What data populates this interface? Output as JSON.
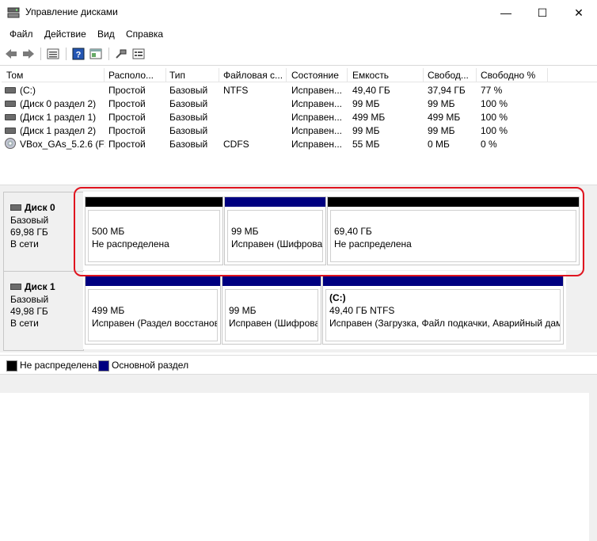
{
  "window": {
    "title": "Управление дисками",
    "controls": {
      "minimize": "—",
      "maximize": "☐",
      "close": "✕"
    }
  },
  "menu": [
    "Файл",
    "Действие",
    "Вид",
    "Справка"
  ],
  "toolbar_icons": [
    "back-icon",
    "forward-icon",
    "list-view-icon",
    "help-icon",
    "properties-icon",
    "connect-icon",
    "settings-icon"
  ],
  "volume_list": {
    "columns": [
      "Том",
      "Располо...",
      "Тип",
      "Файловая с...",
      "Состояние",
      "Емкость",
      "Свобод...",
      "Свободно %"
    ],
    "rows": [
      {
        "icon": "drive",
        "tom": "(C:)",
        "layout": "Простой",
        "type": "Базовый",
        "fs": "NTFS",
        "state": "Исправен...",
        "capacity": "49,40 ГБ",
        "free": "37,94 ГБ",
        "free_pct": "77 %"
      },
      {
        "icon": "drive",
        "tom": "(Диск 0 раздел 2)",
        "layout": "Простой",
        "type": "Базовый",
        "fs": "",
        "state": "Исправен...",
        "capacity": "99 МБ",
        "free": "99 МБ",
        "free_pct": "100 %"
      },
      {
        "icon": "drive",
        "tom": "(Диск 1 раздел 1)",
        "layout": "Простой",
        "type": "Базовый",
        "fs": "",
        "state": "Исправен...",
        "capacity": "499 МБ",
        "free": "499 МБ",
        "free_pct": "100 %"
      },
      {
        "icon": "drive",
        "tom": "(Диск 1 раздел 2)",
        "layout": "Простой",
        "type": "Базовый",
        "fs": "",
        "state": "Исправен...",
        "capacity": "99 МБ",
        "free": "99 МБ",
        "free_pct": "100 %"
      },
      {
        "icon": "cd",
        "tom": "VBox_GAs_5.2.6 (F:)",
        "layout": "Простой",
        "type": "Базовый",
        "fs": "CDFS",
        "state": "Исправен...",
        "capacity": "55 МБ",
        "free": "0 МБ",
        "free_pct": "0 %"
      }
    ]
  },
  "disks": [
    {
      "name": "Диск 0",
      "type": "Базовый",
      "size": "69,98 ГБ",
      "status": "В сети",
      "partitions": [
        {
          "title": "",
          "line1": "500 МБ",
          "line2": "Не распределена",
          "color": "#000000"
        },
        {
          "title": "",
          "line1": "99 МБ",
          "line2": "Исправен (Шифрова",
          "color": "#000080"
        },
        {
          "title": "",
          "line1": "69,40 ГБ",
          "line2": "Не распределена",
          "color": "#000000"
        }
      ]
    },
    {
      "name": "Диск 1",
      "type": "Базовый",
      "size": "49,98 ГБ",
      "status": "В сети",
      "partitions": [
        {
          "title": "",
          "line1": "499 МБ",
          "line2": "Исправен (Раздел восстанов",
          "color": "#000080"
        },
        {
          "title": "",
          "line1": "99 МБ",
          "line2": "Исправен (Шифрова",
          "color": "#000080"
        },
        {
          "title": "(C:)",
          "line1": "49,40 ГБ NTFS",
          "line2": "Исправен (Загрузка, Файл подкачки, Аварийный дам",
          "color": "#000080"
        }
      ]
    }
  ],
  "legend": [
    {
      "label": "Не распределена",
      "color": "#000000"
    },
    {
      "label": "Основной раздел",
      "color": "#000080"
    }
  ]
}
